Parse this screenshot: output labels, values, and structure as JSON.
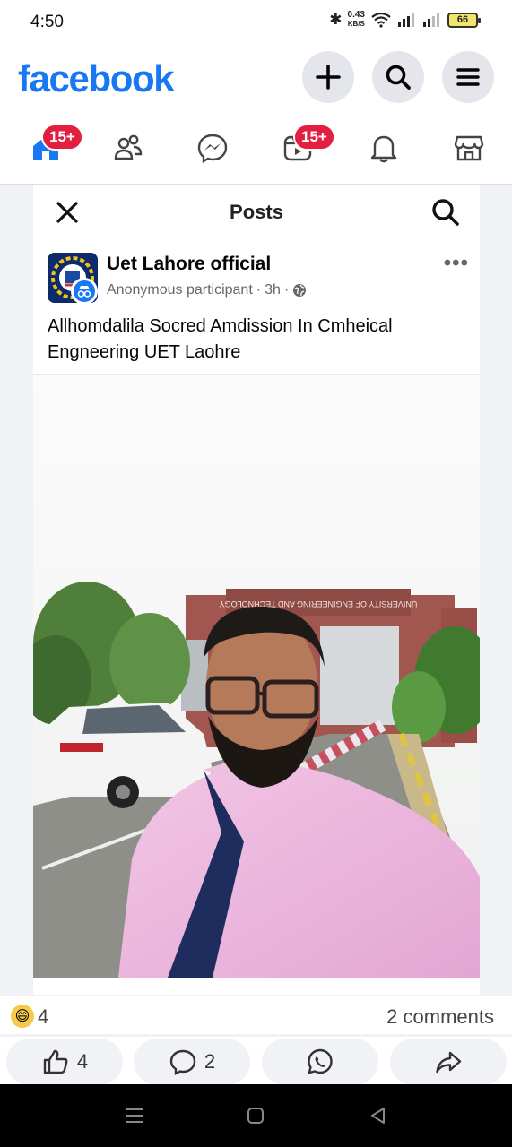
{
  "status_bar": {
    "time": "4:50",
    "net_speed_value": "0.43",
    "net_speed_unit": "KB/S",
    "battery": "66"
  },
  "header": {
    "logo": "facebook",
    "buttons": [
      "plus-icon",
      "search-icon",
      "menu-icon"
    ]
  },
  "nav": {
    "tabs": [
      {
        "name": "home",
        "badge": "15+"
      },
      {
        "name": "friends",
        "badge": ""
      },
      {
        "name": "messenger",
        "badge": ""
      },
      {
        "name": "video",
        "badge": "15+"
      },
      {
        "name": "notifications",
        "badge": ""
      },
      {
        "name": "marketplace",
        "badge": ""
      }
    ]
  },
  "posts_view": {
    "title": "Posts"
  },
  "post": {
    "author": "Uet Lahore official",
    "participant": "Anonymous participant",
    "time": "3h",
    "separator": "·",
    "text": "Allhomdalila Socred Amdission In Cmheical Engneering UET Laohre",
    "sign_text": "UNIVERSITY OF ENGINEERING AND TECHNOLOGY"
  },
  "summary": {
    "reaction_count": "4",
    "comments": "2 comments"
  },
  "actions": {
    "like_count": "4",
    "comment_count": "2"
  },
  "colors": {
    "brand": "#1877f2",
    "badge": "#e41e3f",
    "muted": "#65676b"
  }
}
